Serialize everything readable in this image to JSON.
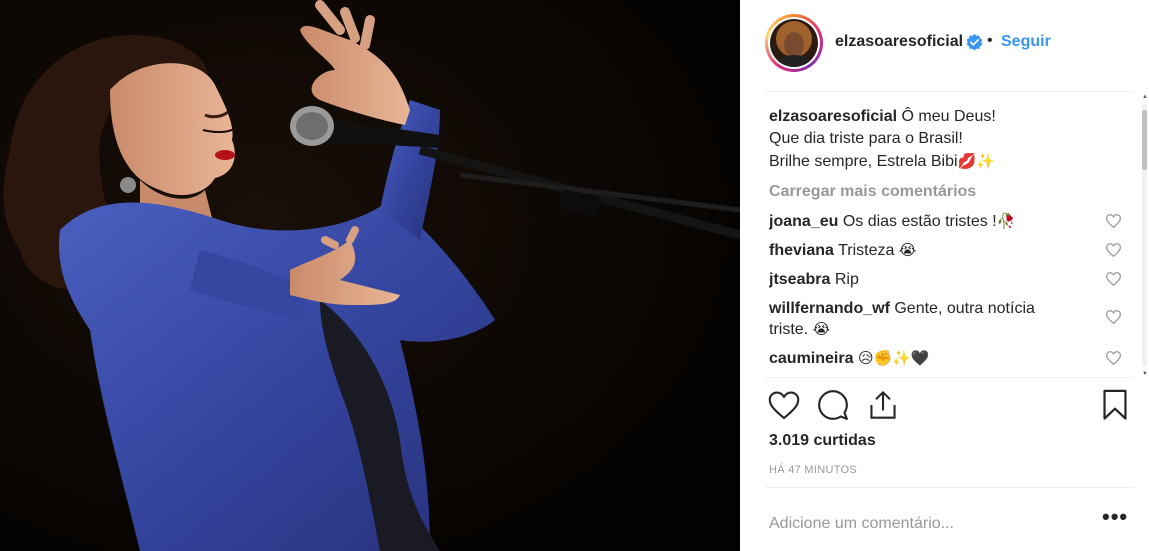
{
  "post": {
    "owner": "elzasoaresoficial",
    "dot": "•",
    "follow_label": "Seguir",
    "caption_lines": [
      "Ô meu Deus!",
      "Que dia triste para o Brasil!",
      "Brilhe sempre, Estrela Bibi"
    ],
    "caption_emojis": "💋✨",
    "load_more": "Carregar mais comentários",
    "comments": [
      {
        "user": "joana_eu",
        "text": "Os dias estão tristes !",
        "emoji": "🥀"
      },
      {
        "user": "fheviana",
        "text": "Tristeza",
        "emoji": "😭"
      },
      {
        "user": "jtseabra",
        "text": "Rip",
        "emoji": ""
      },
      {
        "user": "willfernando_wf",
        "text": "Gente, outra notícia triste.",
        "emoji": "😭"
      },
      {
        "user": "caumineira",
        "text": "",
        "emoji": "😥✊✨🖤"
      }
    ],
    "likes": "3.019 curtidas",
    "time": "HÁ 47 MINUTOS",
    "comment_placeholder": "Adicione um comentário...",
    "more_label": "•••"
  },
  "icons": {
    "verified": "verified-badge-icon",
    "like": "heart-outline-icon",
    "comment": "comment-bubble-icon",
    "share": "share-upload-icon",
    "save": "bookmark-icon",
    "comment_like": "small-heart-icon"
  },
  "colors": {
    "link": "#3897f0",
    "text": "#262626",
    "muted": "#999999",
    "divider": "#efefef",
    "dress": "#3a4fa8"
  }
}
